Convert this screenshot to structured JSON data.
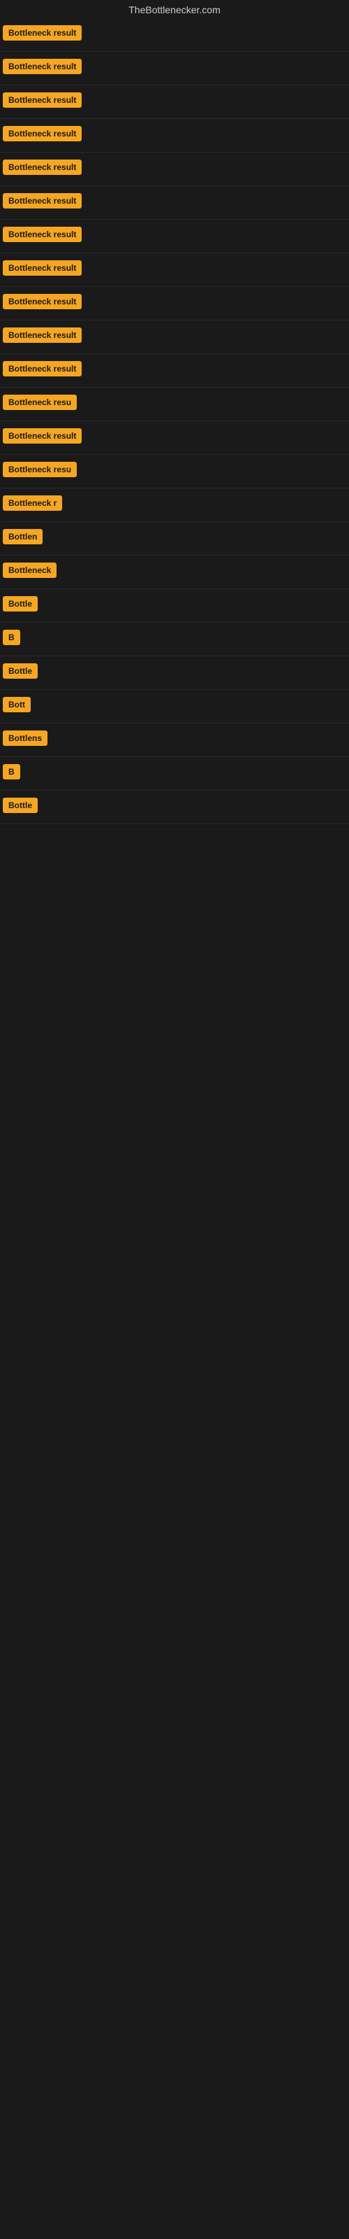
{
  "site": {
    "title": "TheBottlenecker.com"
  },
  "results": [
    {
      "id": 1,
      "label": "Bottleneck result",
      "visible_text": "Bottleneck result"
    },
    {
      "id": 2,
      "label": "Bottleneck result",
      "visible_text": "Bottleneck result"
    },
    {
      "id": 3,
      "label": "Bottleneck result",
      "visible_text": "Bottleneck result"
    },
    {
      "id": 4,
      "label": "Bottleneck result",
      "visible_text": "Bottleneck result"
    },
    {
      "id": 5,
      "label": "Bottleneck result",
      "visible_text": "Bottleneck result"
    },
    {
      "id": 6,
      "label": "Bottleneck result",
      "visible_text": "Bottleneck result"
    },
    {
      "id": 7,
      "label": "Bottleneck result",
      "visible_text": "Bottleneck result"
    },
    {
      "id": 8,
      "label": "Bottleneck result",
      "visible_text": "Bottleneck result"
    },
    {
      "id": 9,
      "label": "Bottleneck result",
      "visible_text": "Bottleneck result"
    },
    {
      "id": 10,
      "label": "Bottleneck result",
      "visible_text": "Bottleneck result"
    },
    {
      "id": 11,
      "label": "Bottleneck result",
      "visible_text": "Bottleneck result"
    },
    {
      "id": 12,
      "label": "Bottleneck resu",
      "visible_text": "Bottleneck resu"
    },
    {
      "id": 13,
      "label": "Bottleneck result",
      "visible_text": "Bottleneck result"
    },
    {
      "id": 14,
      "label": "Bottleneck resu",
      "visible_text": "Bottleneck resu"
    },
    {
      "id": 15,
      "label": "Bottleneck r",
      "visible_text": "Bottleneck r"
    },
    {
      "id": 16,
      "label": "Bottlen",
      "visible_text": "Bottlen"
    },
    {
      "id": 17,
      "label": "Bottleneck",
      "visible_text": "Bottleneck"
    },
    {
      "id": 18,
      "label": "Bottle",
      "visible_text": "Bottle"
    },
    {
      "id": 19,
      "label": "B",
      "visible_text": "B"
    },
    {
      "id": 20,
      "label": "Bottle",
      "visible_text": "Bottle"
    },
    {
      "id": 21,
      "label": "Bott",
      "visible_text": "Bott"
    },
    {
      "id": 22,
      "label": "Bottlens",
      "visible_text": "Bottlens"
    },
    {
      "id": 23,
      "label": "B",
      "visible_text": "B"
    },
    {
      "id": 24,
      "label": "Bottle",
      "visible_text": "Bottle"
    }
  ]
}
